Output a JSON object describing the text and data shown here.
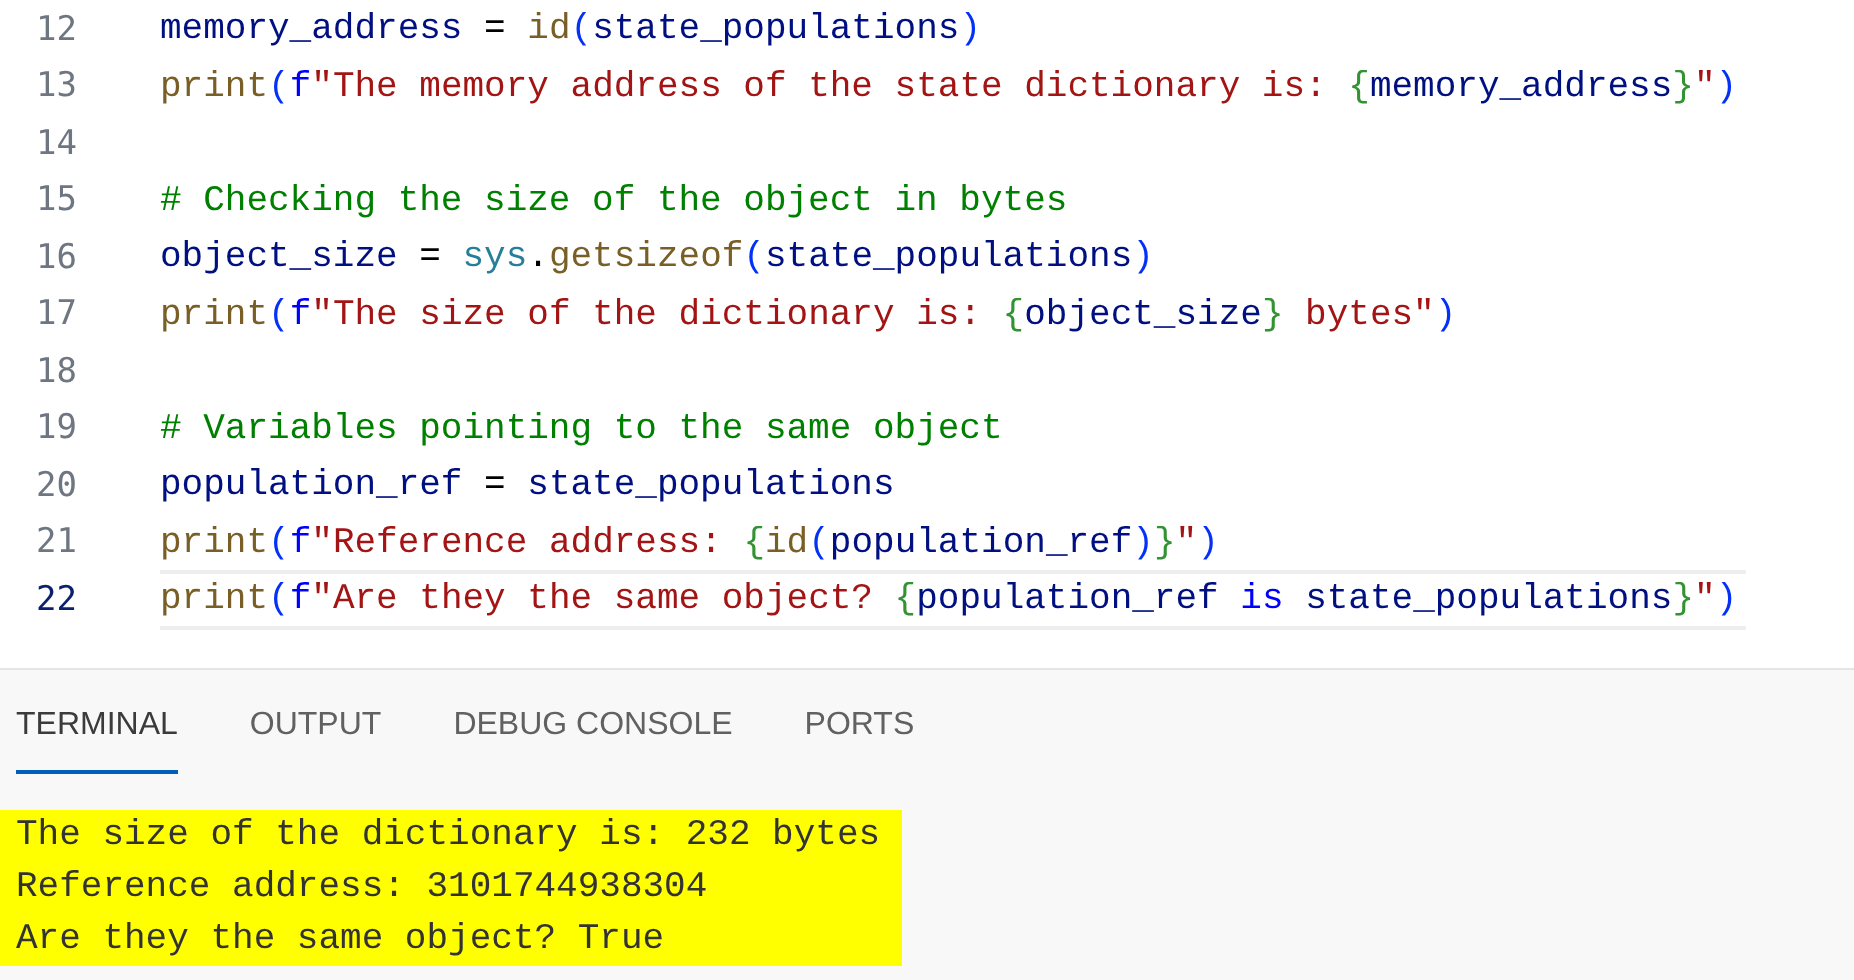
{
  "editor": {
    "lines": [
      {
        "number": "12",
        "current": false,
        "tokens": [
          {
            "kind": "var",
            "text": "memory_address"
          },
          {
            "kind": "plain",
            "text": " = "
          },
          {
            "kind": "func",
            "text": "id"
          },
          {
            "kind": "paren",
            "text": "("
          },
          {
            "kind": "var",
            "text": "state_populations"
          },
          {
            "kind": "paren",
            "text": ")"
          }
        ]
      },
      {
        "number": "13",
        "current": false,
        "tokens": [
          {
            "kind": "func",
            "text": "print"
          },
          {
            "kind": "paren",
            "text": "("
          },
          {
            "kind": "keyword",
            "text": "f"
          },
          {
            "kind": "string",
            "text": "\"The memory address of the state dictionary is: "
          },
          {
            "kind": "brace",
            "text": "{"
          },
          {
            "kind": "var",
            "text": "memory_address"
          },
          {
            "kind": "brace",
            "text": "}"
          },
          {
            "kind": "string",
            "text": "\""
          },
          {
            "kind": "paren",
            "text": ")"
          }
        ]
      },
      {
        "number": "14",
        "current": false
      },
      {
        "number": "15",
        "current": false,
        "tokens": [
          {
            "kind": "comment",
            "text": "# Checking the size of the object in bytes"
          }
        ]
      },
      {
        "number": "16",
        "current": false,
        "tokens": [
          {
            "kind": "var",
            "text": "object_size"
          },
          {
            "kind": "plain",
            "text": " = "
          },
          {
            "kind": "module",
            "text": "sys"
          },
          {
            "kind": "plain",
            "text": "."
          },
          {
            "kind": "func",
            "text": "getsizeof"
          },
          {
            "kind": "paren",
            "text": "("
          },
          {
            "kind": "var",
            "text": "state_populations"
          },
          {
            "kind": "paren",
            "text": ")"
          }
        ]
      },
      {
        "number": "17",
        "current": false,
        "tokens": [
          {
            "kind": "func",
            "text": "print"
          },
          {
            "kind": "paren",
            "text": "("
          },
          {
            "kind": "keyword",
            "text": "f"
          },
          {
            "kind": "string",
            "text": "\"The size of the dictionary is: "
          },
          {
            "kind": "brace",
            "text": "{"
          },
          {
            "kind": "var",
            "text": "object_size"
          },
          {
            "kind": "brace",
            "text": "}"
          },
          {
            "kind": "string",
            "text": " bytes\""
          },
          {
            "kind": "paren",
            "text": ")"
          }
        ]
      },
      {
        "number": "18",
        "current": false
      },
      {
        "number": "19",
        "current": false,
        "tokens": [
          {
            "kind": "comment",
            "text": "# Variables pointing to the same object"
          }
        ]
      },
      {
        "number": "20",
        "current": false,
        "tokens": [
          {
            "kind": "var",
            "text": "population_ref"
          },
          {
            "kind": "plain",
            "text": " = "
          },
          {
            "kind": "var",
            "text": "state_populations"
          }
        ]
      },
      {
        "number": "21",
        "current": false,
        "tokens": [
          {
            "kind": "func",
            "text": "print"
          },
          {
            "kind": "paren",
            "text": "("
          },
          {
            "kind": "keyword",
            "text": "f"
          },
          {
            "kind": "string",
            "text": "\"Reference address: "
          },
          {
            "kind": "brace",
            "text": "{"
          },
          {
            "kind": "func",
            "text": "id"
          },
          {
            "kind": "paren",
            "text": "("
          },
          {
            "kind": "var",
            "text": "population_ref"
          },
          {
            "kind": "paren",
            "text": ")"
          },
          {
            "kind": "brace",
            "text": "}"
          },
          {
            "kind": "string",
            "text": "\""
          },
          {
            "kind": "paren",
            "text": ")"
          }
        ]
      },
      {
        "number": "22",
        "current": true,
        "tokens": [
          {
            "kind": "func",
            "text": "print"
          },
          {
            "kind": "paren",
            "text": "("
          },
          {
            "kind": "keyword",
            "text": "f"
          },
          {
            "kind": "string",
            "text": "\"Are they the same object? "
          },
          {
            "kind": "brace",
            "text": "{"
          },
          {
            "kind": "var",
            "text": "population_ref"
          },
          {
            "kind": "keyword",
            "text": " is "
          },
          {
            "kind": "var",
            "text": "state_populations"
          },
          {
            "kind": "brace",
            "text": "}"
          },
          {
            "kind": "string",
            "text": "\""
          },
          {
            "kind": "paren",
            "text": ")"
          }
        ]
      }
    ]
  },
  "panel": {
    "tabs": [
      {
        "label": "TERMINAL",
        "selected": true
      },
      {
        "label": "OUTPUT",
        "selected": false
      },
      {
        "label": "DEBUG CONSOLE",
        "selected": false
      },
      {
        "label": "PORTS",
        "selected": false
      }
    ],
    "terminal_lines": [
      {
        "text": "The size of the dictionary is: 232 bytes",
        "highlighted": true
      },
      {
        "text": "Reference address: 3101744938304",
        "highlighted": true
      },
      {
        "text": "Are they the same object? True",
        "highlighted": true
      }
    ]
  }
}
